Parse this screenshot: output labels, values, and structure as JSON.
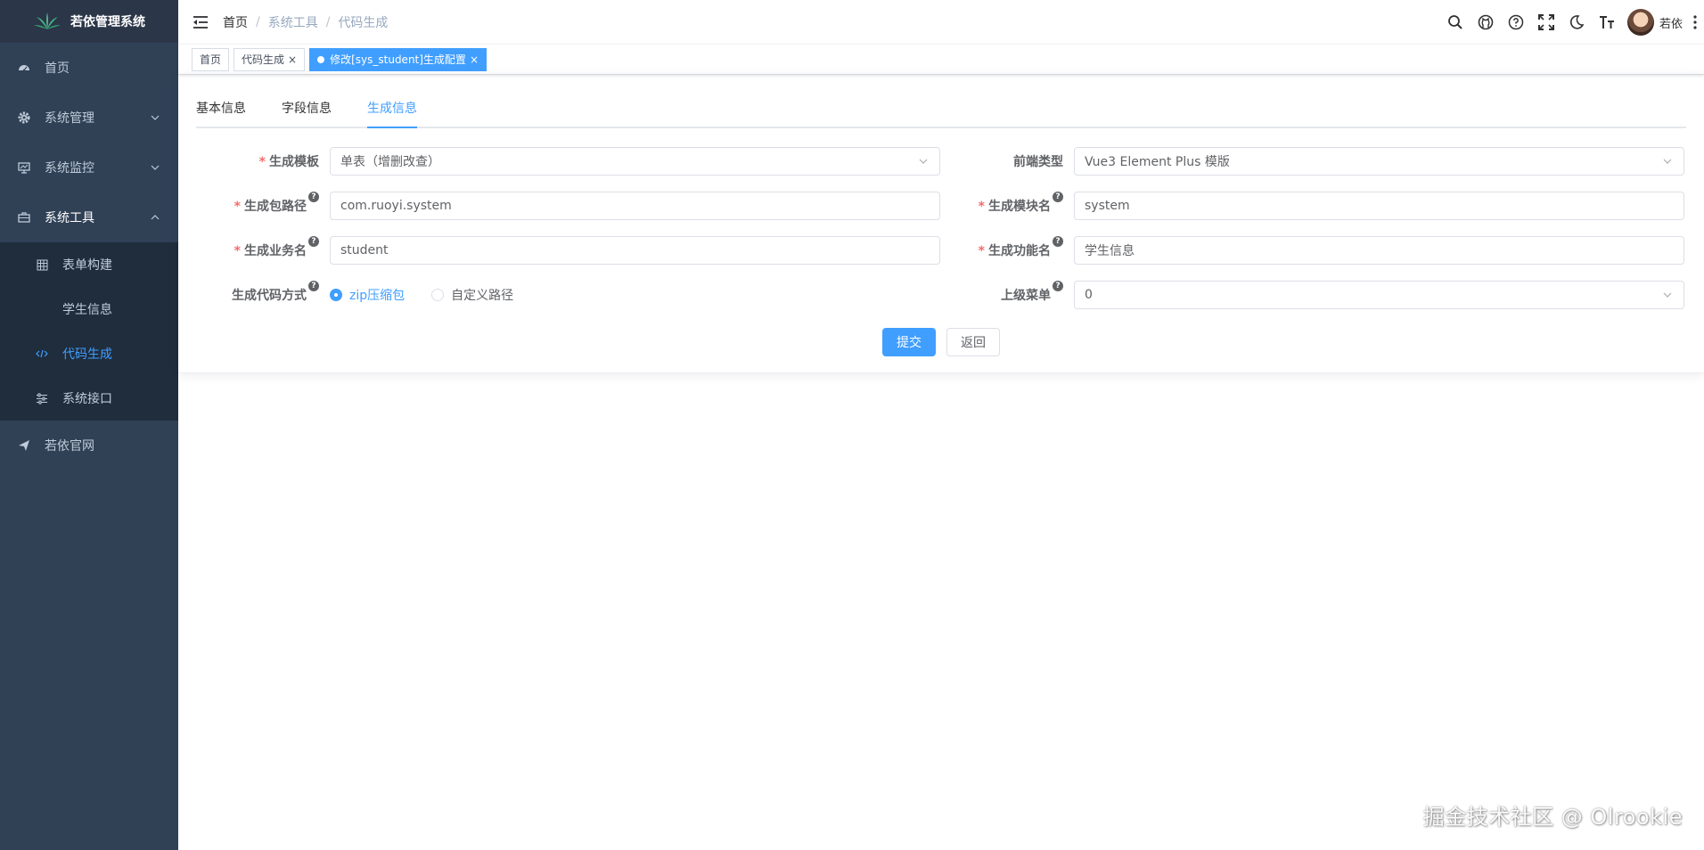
{
  "app": {
    "title": "若依管理系统"
  },
  "sidebar": {
    "items": [
      {
        "label": "首页",
        "icon": "dashboard-icon"
      },
      {
        "label": "系统管理",
        "icon": "gear-icon"
      },
      {
        "label": "系统监控",
        "icon": "monitor-icon"
      },
      {
        "label": "系统工具",
        "icon": "toolbox-icon"
      },
      {
        "label": "若依官网",
        "icon": "send-icon"
      }
    ],
    "submenu": [
      {
        "label": "表单构建",
        "icon": "table-icon"
      },
      {
        "label": "学生信息",
        "icon": ""
      },
      {
        "label": "代码生成",
        "icon": "code-icon"
      },
      {
        "label": "系统接口",
        "icon": "sliders-icon"
      }
    ]
  },
  "header": {
    "breadcrumb": [
      "首页",
      "系统工具",
      "代码生成"
    ],
    "username": "若依"
  },
  "tags": [
    {
      "label": "首页"
    },
    {
      "label": "代码生成",
      "close": "×"
    },
    {
      "label": "修改[sys_student]生成配置",
      "close": "×"
    }
  ],
  "tabs": [
    "基本信息",
    "字段信息",
    "生成信息"
  ],
  "form": {
    "template_label": "生成模板",
    "template_value": "单表（增删改查）",
    "frontend_label": "前端类型",
    "frontend_value": "Vue3 Element Plus 模版",
    "package_label": "生成包路径",
    "package_value": "com.ruoyi.system",
    "module_label": "生成模块名",
    "module_value": "system",
    "business_label": "生成业务名",
    "business_value": "student",
    "function_label": "生成功能名",
    "function_value": "学生信息",
    "gentype_label": "生成代码方式",
    "gentype_opt1": "zip压缩包",
    "gentype_opt2": "自定义路径",
    "parent_menu_label": "上级菜单",
    "parent_menu_value": "0",
    "required_mark": "*",
    "help_mark": "?"
  },
  "buttons": {
    "submit": "提交",
    "back": "返回"
  },
  "watermark": "掘金技术社区 @ Olrookie",
  "colors": {
    "sidebar": "#304156",
    "primary": "#409eff",
    "submenu": "#1f2d3d"
  }
}
